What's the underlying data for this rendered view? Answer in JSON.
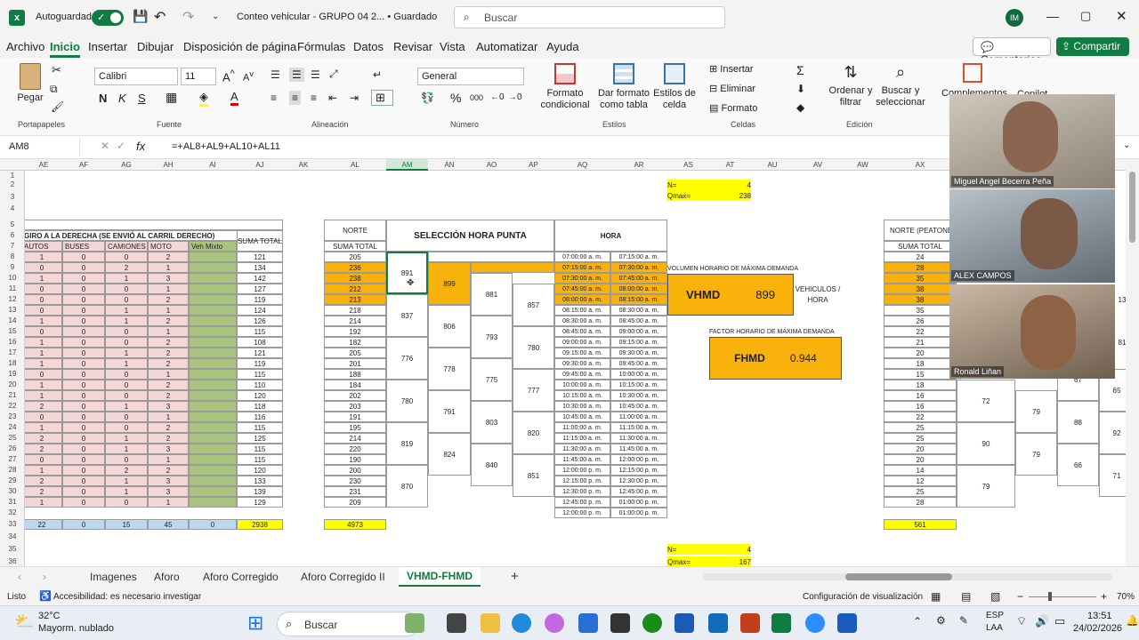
{
  "titlebar": {
    "autosave_label": "Autoguardado",
    "doc_title": "Conteo vehicular - GRUPO 04 2... • Guardado",
    "search_placeholder": "Buscar",
    "user_initials": "IM"
  },
  "menu": [
    "Archivo",
    "Inicio",
    "Insertar",
    "Dibujar",
    "Disposición de página",
    "Fórmulas",
    "Datos",
    "Revisar",
    "Vista",
    "Automatizar",
    "Ayuda"
  ],
  "menu_right": {
    "comments": "Comentarios",
    "share": "Compartir"
  },
  "ribbon": {
    "paste": "Pegar",
    "clipboard": "Portapapeles",
    "font_name": "Calibri",
    "font_size": "11",
    "font_group": "Fuente",
    "alignment_group": "Alineación",
    "number_format": "General",
    "number_group": "Número",
    "cond_format": "Formato condicional",
    "table_format": "Dar formato como tabla",
    "cell_styles": "Estilos de celda",
    "styles_group": "Estilos",
    "insert": "Insertar",
    "delete": "Eliminar",
    "format": "Formato",
    "cells_group": "Celdas",
    "sort_filter": "Ordenar y filtrar",
    "find_select": "Buscar y seleccionar",
    "editing_group": "Edición",
    "complements": "Complementos",
    "copilot": "Copilot"
  },
  "formula": {
    "name_box": "AM8",
    "fx": "fx",
    "content": "=+AL8+AL9+AL10+AL11"
  },
  "columns": [
    "AE",
    "AF",
    "AG",
    "AH",
    "AI",
    "AJ",
    "AK",
    "AL",
    "AM",
    "AN",
    "AO",
    "AP",
    "AQ",
    "AR",
    "AS",
    "AT",
    "AU",
    "AV",
    "AW",
    "AX"
  ],
  "rows": [
    "1",
    "2",
    "3",
    "4",
    "5",
    "6",
    "7",
    "8",
    "9",
    "10",
    "11",
    "12",
    "13",
    "14",
    "15",
    "16",
    "17",
    "18",
    "19",
    "20",
    "21",
    "22",
    "23",
    "24",
    "25",
    "26",
    "27",
    "28",
    "29",
    "30",
    "31",
    "32",
    "33",
    "34",
    "35",
    "36"
  ],
  "left_table": {
    "title": "GIRO A LA DERECHA (SE ENVIÓ AL CARRIL DERECHO)",
    "headers": [
      "AUTOS",
      "BUSES",
      "CAMIONES",
      "MOTO",
      "Veh Mixto"
    ],
    "sum_header": "SUMA TOTAL",
    "rows": [
      [
        "1",
        "0",
        "0",
        "2",
        "121"
      ],
      [
        "0",
        "0",
        "2",
        "1",
        "134"
      ],
      [
        "1",
        "0",
        "1",
        "3",
        "142"
      ],
      [
        "0",
        "0",
        "0",
        "1",
        "127"
      ],
      [
        "0",
        "0",
        "0",
        "2",
        "119"
      ],
      [
        "0",
        "0",
        "1",
        "1",
        "124"
      ],
      [
        "1",
        "0",
        "1",
        "2",
        "126"
      ],
      [
        "0",
        "0",
        "0",
        "1",
        "115"
      ],
      [
        "1",
        "0",
        "0",
        "2",
        "108"
      ],
      [
        "1",
        "0",
        "1",
        "2",
        "121"
      ],
      [
        "1",
        "0",
        "1",
        "2",
        "119"
      ],
      [
        "0",
        "0",
        "0",
        "1",
        "115"
      ],
      [
        "1",
        "0",
        "0",
        "2",
        "110"
      ],
      [
        "1",
        "0",
        "0",
        "2",
        "120"
      ],
      [
        "2",
        "0",
        "1",
        "3",
        "118"
      ],
      [
        "0",
        "0",
        "0",
        "1",
        "116"
      ],
      [
        "1",
        "0",
        "0",
        "2",
        "115"
      ],
      [
        "2",
        "0",
        "1",
        "2",
        "125"
      ],
      [
        "2",
        "0",
        "1",
        "3",
        "115"
      ],
      [
        "0",
        "0",
        "0",
        "1",
        "115"
      ],
      [
        "1",
        "0",
        "2",
        "2",
        "120"
      ],
      [
        "2",
        "0",
        "1",
        "3",
        "133"
      ],
      [
        "2",
        "0",
        "1",
        "3",
        "139"
      ],
      [
        "1",
        "0",
        "0",
        "1",
        "129"
      ]
    ],
    "totals": [
      "22",
      "0",
      "15",
      "45",
      "0",
      "2938"
    ]
  },
  "norte": {
    "header": "NORTE",
    "sub": "SUMA TOTAL",
    "values": [
      "205",
      "236",
      "238",
      "212",
      "213",
      "218",
      "214",
      "192",
      "182",
      "205",
      "201",
      "188",
      "184",
      "202",
      "203",
      "191",
      "195",
      "214",
      "220",
      "190",
      "200",
      "230",
      "231",
      "209"
    ],
    "total": "4973"
  },
  "seleccion": {
    "title": "SELECCIÓN HORA PUNTA",
    "am": [
      "891",
      "837",
      "776",
      "780",
      "819",
      "870"
    ],
    "an": [
      "899",
      "806",
      "778",
      "791",
      "824"
    ],
    "ao": [
      "881",
      "793",
      "775",
      "803",
      "840"
    ],
    "ap": [
      "857",
      "780",
      "777",
      "820",
      "851"
    ]
  },
  "hora": {
    "header": "HORA",
    "rows": [
      [
        "07:00:00 a. m.",
        "07:15:00 a. m."
      ],
      [
        "07:15:00 a. m.",
        "07:30:00 a. m."
      ],
      [
        "07:30:00 a. m.",
        "07:45:00 a. m."
      ],
      [
        "07:45:00 a. m.",
        "08:00:00 a. m."
      ],
      [
        "08:00:00 a. m.",
        "08:15:00 a. m."
      ],
      [
        "08:15:00 a. m.",
        "08:30:00 a. m."
      ],
      [
        "08:30:00 a. m.",
        "08:45:00 a. m."
      ],
      [
        "08:45:00 a. m.",
        "09:00:00 a. m."
      ],
      [
        "09:00:00 a. m.",
        "09:15:00 a. m."
      ],
      [
        "09:15:00 a. m.",
        "09:30:00 a. m."
      ],
      [
        "09:30:00 a. m.",
        "09:45:00 a. m."
      ],
      [
        "09:45:00 a. m.",
        "10:00:00 a. m."
      ],
      [
        "10:00:00 a. m.",
        "10:15:00 a. m."
      ],
      [
        "10:15:00 a. m.",
        "10:30:00 a. m."
      ],
      [
        "10:30:00 a. m.",
        "10:45:00 a. m."
      ],
      [
        "10:45:00 a. m.",
        "11:00:00 a. m."
      ],
      [
        "11:00:00 a. m.",
        "11:15:00 a. m."
      ],
      [
        "11:15:00 a. m.",
        "11:30:00 a. m."
      ],
      [
        "11:30:00 a. m.",
        "11:45:00 a. m."
      ],
      [
        "11:45:00 a. m.",
        "12:00:00 p. m."
      ],
      [
        "12:00:00 p. m.",
        "12:15:00 p. m."
      ],
      [
        "12:15:00 p. m.",
        "12:30:00 p. m."
      ],
      [
        "12:30:00 p. m.",
        "12:45:00 p. m."
      ],
      [
        "12:45:00 p. m.",
        "01:00:00 p. m."
      ],
      [
        "12:00:00 p. m.",
        "01:00:00 p. m."
      ]
    ]
  },
  "params_top": {
    "n_label": "N=",
    "n_value": "4",
    "q_label": "Qmax=",
    "q_value": "238"
  },
  "params_bottom": {
    "n_label": "N=",
    "n_value": "4",
    "q_label": "Qmax=",
    "q_value": "167"
  },
  "vhmd": {
    "caption": "VOLUMEN HORARIO DE MÁXIMA DEMANDA",
    "label": "VHMD",
    "value": "899",
    "unit1": "VEHICULOS /",
    "unit2": "HORA"
  },
  "fhmd": {
    "caption": "FACTOR HORARIO DE MÁXIMA DEMANDA",
    "label": "FHMD",
    "value": "0.944"
  },
  "peatones": {
    "header": "NORTE (PEATONES",
    "sub": "SUMA TOTAL",
    "values": [
      "24",
      "28",
      "35",
      "38",
      "38",
      "35",
      "26",
      "22",
      "21",
      "20",
      "18",
      "15",
      "18",
      "16",
      "16",
      "22",
      "25",
      "25",
      "20",
      "20",
      "14",
      "12",
      "25",
      "28"
    ],
    "total": "561",
    "ba": [
      "72",
      "90",
      "79"
    ],
    "bb": [
      "79",
      "79"
    ],
    "bc": [
      "67",
      "88",
      "66"
    ],
    "bd": [
      "65",
      "92",
      "71"
    ],
    "edge": [
      "13",
      "81"
    ]
  },
  "tabs": [
    "Imagenes",
    "Aforo",
    "Aforo Corregido",
    "Aforo Corregido II",
    "VHMD-FHMD"
  ],
  "status": {
    "ready": "Listo",
    "accessibility": "Accesibilidad: es necesario investigar",
    "view_settings": "Configuración de visualización",
    "zoom": "70%"
  },
  "taskbar": {
    "temp": "32°C",
    "weather": "Mayorm. nublado",
    "search": "Buscar",
    "lang1": "ESP",
    "lang2": "LAA",
    "time": "13:51",
    "date": "24/02/2026"
  },
  "video": {
    "p1": "Miguel Angel Becerra Peña",
    "p2": "ALEX CAMPOS",
    "p3": "Ronald Liñan"
  },
  "colors": {
    "excel_green": "#107c41",
    "orange": "#f9b20c",
    "yellow": "#ffff00",
    "pink": "#f4d6d6",
    "green": "#a9c47f"
  }
}
